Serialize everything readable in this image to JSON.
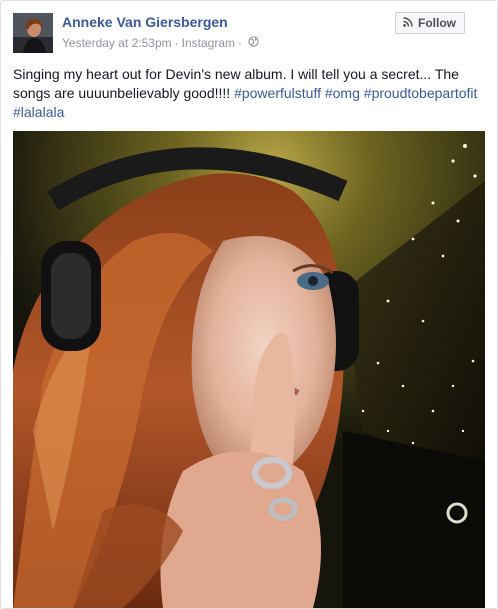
{
  "post": {
    "author": "Anneke Van Giersbergen",
    "timestamp": "Yesterday at 2:53pm",
    "source": "Instagram",
    "separator": "·",
    "privacy_icon": "globe-icon",
    "follow_label": "Follow",
    "follow_icon": "rss-icon",
    "text": "Singing my heart out for Devin's new album. I will tell you a secret... The songs are uuuunbelievably good!!!!",
    "hashtags": [
      "#powerfulstuff",
      "#omg",
      "#proudtobepartofit",
      "#lalalala"
    ],
    "photo": {
      "kind": "selfie-photo",
      "description_icon": "photo"
    }
  },
  "colors": {
    "link": "#3b5998",
    "text": "#141823",
    "meta": "#90949c",
    "border": "#dddfe2"
  }
}
